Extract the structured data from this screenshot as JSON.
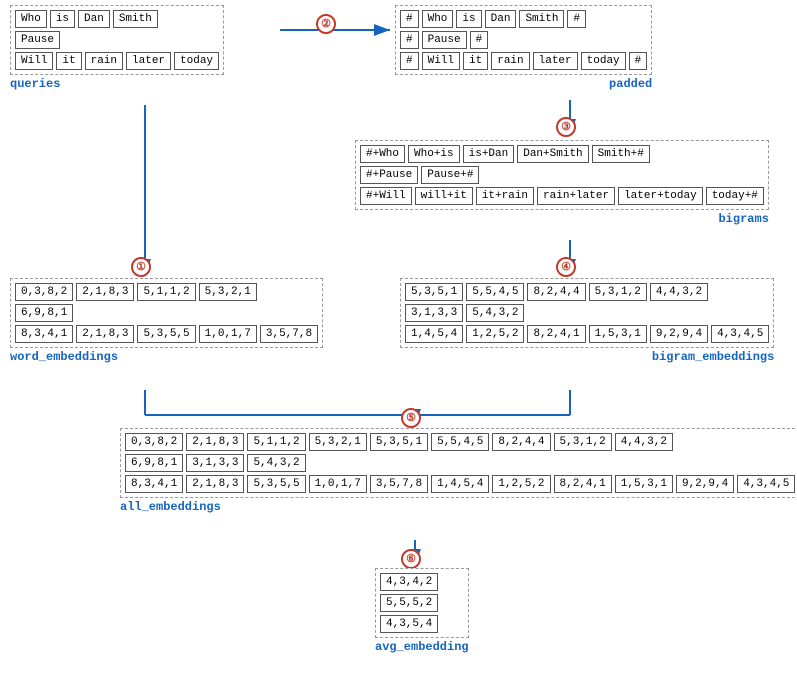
{
  "queries": {
    "label": "queries",
    "rows": [
      [
        "Who",
        "is",
        "Dan",
        "Smith"
      ],
      [
        "Pause"
      ],
      [
        "Will",
        "it",
        "rain",
        "later",
        "today"
      ]
    ]
  },
  "padded": {
    "label": "padded",
    "rows": [
      [
        "#",
        "Who",
        "is",
        "Dan",
        "Smith",
        "#"
      ],
      [
        "#",
        "Pause",
        "#"
      ],
      [
        "#",
        "Will",
        "it",
        "rain",
        "later",
        "today",
        "#"
      ]
    ]
  },
  "bigrams": {
    "label": "bigrams",
    "rows": [
      [
        "#+Who",
        "Who+is",
        "is+Dan",
        "Dan+Smith",
        "Smith+#"
      ],
      [
        "#+Pause",
        "Pause+#"
      ],
      [
        "#+Will",
        "will+it",
        "it+rain",
        "rain+later",
        "later+today",
        "today+#"
      ]
    ]
  },
  "word_embeddings": {
    "label": "word_embeddings",
    "rows": [
      [
        "0,3,8,2",
        "2,1,8,3",
        "5,1,1,2",
        "5,3,2,1"
      ],
      [
        "6,9,8,1"
      ],
      [
        "8,3,4,1",
        "2,1,8,3",
        "5,3,5,5",
        "1,0,1,7",
        "3,5,7,8"
      ]
    ]
  },
  "bigram_embeddings": {
    "label": "bigram_embeddings",
    "rows": [
      [
        "5,3,5,1",
        "5,5,4,5",
        "8,2,4,4",
        "5,3,1,2",
        "4,4,3,2"
      ],
      [
        "3,1,3,3",
        "5,4,3,2"
      ],
      [
        "1,4,5,4",
        "1,2,5,2",
        "8,2,4,1",
        "1,5,3,1",
        "9,2,9,4",
        "4,3,4,5"
      ]
    ]
  },
  "all_embeddings": {
    "label": "all_embeddings",
    "rows": [
      [
        "0,3,8,2",
        "2,1,8,3",
        "5,1,1,2",
        "5,3,2,1",
        "5,3,5,1",
        "5,5,4,5",
        "8,2,4,4",
        "5,3,1,2",
        "4,4,3,2"
      ],
      [
        "6,9,8,1",
        "3,1,3,3",
        "5,4,3,2"
      ],
      [
        "8,3,4,1",
        "2,1,8,3",
        "5,3,5,5",
        "1,0,1,7",
        "3,5,7,8",
        "1,4,5,4",
        "1,2,5,2",
        "8,2,4,1",
        "1,5,3,1",
        "9,2,9,4",
        "4,3,4,5"
      ]
    ]
  },
  "avg_embedding": {
    "label": "avg_embedding",
    "rows": [
      [
        "4,3,4,2"
      ],
      [
        "5,5,5,2"
      ],
      [
        "4,3,5,4"
      ]
    ]
  },
  "circles": {
    "c1": "①",
    "c2": "②",
    "c3": "③",
    "c4": "④",
    "c5": "⑤",
    "c6": "⑥"
  }
}
